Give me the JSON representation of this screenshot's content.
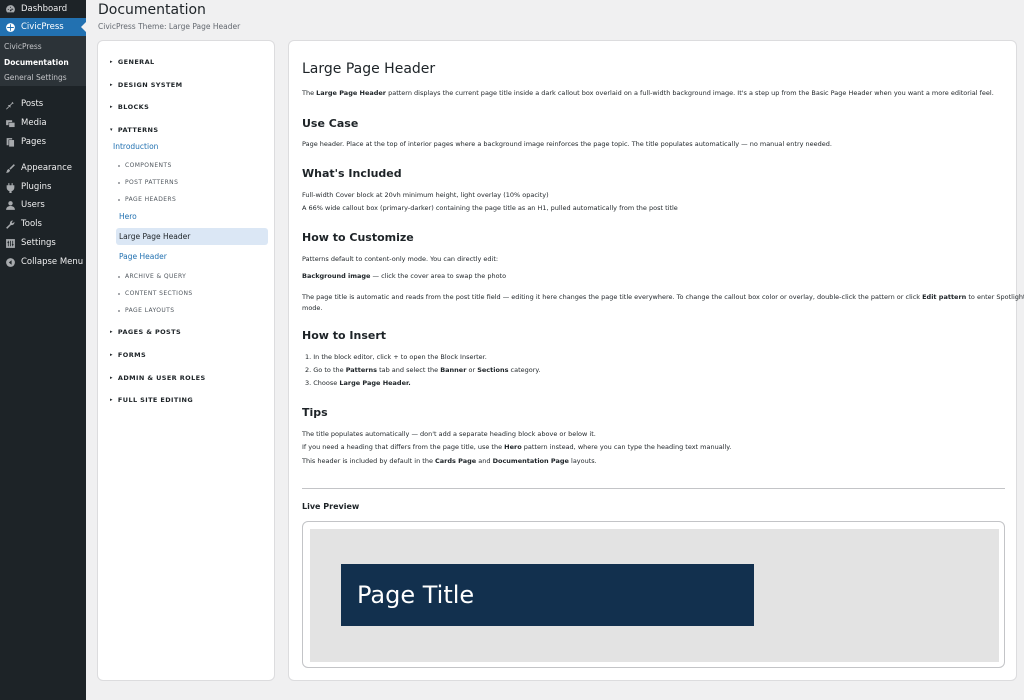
{
  "admin_menu": {
    "items": [
      {
        "label": "Dashboard",
        "icon": "dashboard-icon"
      },
      {
        "label": "CivicPress",
        "icon": "civicpress-icon",
        "active": true
      },
      {
        "label": "Posts",
        "icon": "pin-icon"
      },
      {
        "label": "Media",
        "icon": "media-icon"
      },
      {
        "label": "Pages",
        "icon": "pages-icon"
      },
      {
        "label": "Appearance",
        "icon": "brush-icon"
      },
      {
        "label": "Plugins",
        "icon": "plug-icon"
      },
      {
        "label": "Users",
        "icon": "user-icon"
      },
      {
        "label": "Tools",
        "icon": "wrench-icon"
      },
      {
        "label": "Settings",
        "icon": "settings-icon"
      },
      {
        "label": "Collapse Menu",
        "icon": "collapse-icon"
      }
    ],
    "submenu": [
      {
        "label": "CivicPress"
      },
      {
        "label": "Documentation",
        "current": true
      },
      {
        "label": "General Settings"
      }
    ],
    "accent": "#2271b1"
  },
  "header": {
    "title": "Documentation",
    "subtitle": "CivicPress Theme: Large Page Header"
  },
  "docs_nav": {
    "sections": {
      "general": "GENERAL",
      "design_system": "DESIGN SYSTEM",
      "blocks": "BLOCKS",
      "patterns": "PATTERNS",
      "pages_posts": "PAGES & POSTS",
      "forms": "FORMS",
      "admin_roles": "ADMIN & USER ROLES",
      "fse": "FULL SITE EDITING"
    },
    "introduction": "Introduction",
    "subsections": {
      "components": "COMPONENTS",
      "post_patterns": "POST PATTERNS",
      "page_headers": "PAGE HEADERS",
      "archive_query": "ARCHIVE & QUERY",
      "content_sections": "CONTENT SECTIONS",
      "page_layouts": "PAGE LAYOUTS"
    },
    "page_headers_items": {
      "hero": "Hero",
      "large_page_header": "Large Page Header",
      "page_header": "Page Header"
    }
  },
  "content": {
    "title": "Large Page Header",
    "intro": {
      "pre": "The ",
      "bold": "Large Page Header",
      "post": " pattern displays the current page title inside a dark callout box overlaid on a full-width background image. It's a step up from the Basic Page Header when you want a more editorial feel."
    },
    "use_case": {
      "heading": "Use Case",
      "text": "Page header. Place at the top of interior pages where a background image reinforces the page topic. The title populates automatically — no manual entry needed."
    },
    "included": {
      "heading": "What's Included",
      "items": [
        "Full-width Cover block at 20vh minimum height, light overlay (10% opacity)",
        "A 66% wide callout box (primary-darker) containing the page title as an H1, pulled automatically from the post title"
      ]
    },
    "customize": {
      "heading": "How to Customize",
      "line1": "Patterns default to content-only mode. You can directly edit:",
      "bg_bold": "Background image",
      "bg_rest": " — click the cover area to swap the photo",
      "para_1": "The page title is automatic and reads from the post title field — editing it here changes the page title everywhere. To change the callout box color or overlay, double-click the pattern or click ",
      "para_bold": "Edit pattern",
      "para_2": " to enter Spotlight",
      "para_3": "mode."
    },
    "insert": {
      "heading": "How to Insert",
      "step1": "1.  In the block editor, click + to open the Block Inserter.",
      "step2_pre": "2.  Go to the ",
      "step2_b1": "Patterns",
      "step2_mid": " tab and select the ",
      "step2_b2": "Banner",
      "step2_or": " or ",
      "step2_b3": "Sections",
      "step2_post": " category.",
      "step3_pre": "3.  Choose ",
      "step3_bold": "Large Page Header."
    },
    "tips": {
      "heading": "Tips",
      "tip1": "The title populates automatically — don't add a separate heading block above or below it.",
      "tip2_pre": "If you need a heading that differs from the page title, use the ",
      "tip2_bold": "Hero",
      "tip2_post": " pattern instead, where you can type the heading text manually.",
      "tip3_pre": "This header is included by default in the ",
      "tip3_b1": "Cards Page",
      "tip3_mid": " and ",
      "tip3_b2": "Documentation Page",
      "tip3_post": " layouts."
    },
    "live_preview": {
      "heading": "Live Preview",
      "callout_title": "Page Title",
      "callout_color": "#12304e"
    }
  }
}
